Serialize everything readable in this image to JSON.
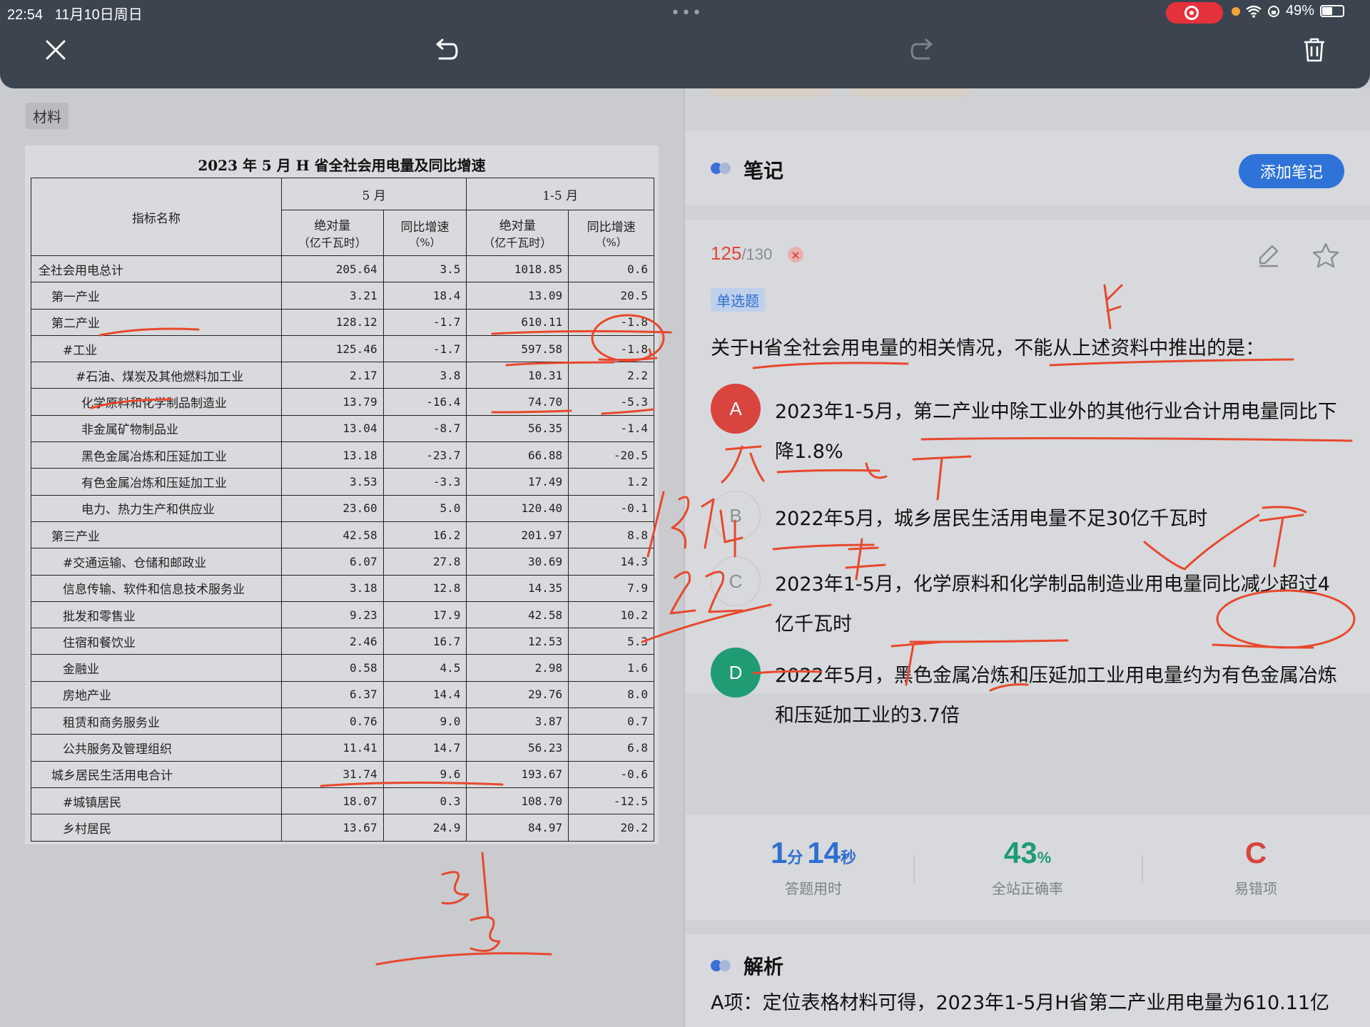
{
  "status_bar": {
    "time": "22:54",
    "date": "11月10日周日",
    "battery": "49%"
  },
  "toolbar": {
    "close_icon": "close-icon",
    "undo_icon": "undo-icon",
    "redo_icon": "redo-icon",
    "delete_icon": "trash-icon"
  },
  "material": {
    "tag": "材料",
    "table_title": "2023 年 5 月 H 省全社会用电量及同比增速",
    "headers": {
      "name": "指标名称",
      "group1": "5 月",
      "group2": "1-5 月",
      "abs_label": "绝对量",
      "abs_unit": "（亿千瓦时）",
      "growth_label": "同比增速",
      "growth_unit": "（%）"
    },
    "rows": [
      {
        "name": "全社会用电总计",
        "indent": 0,
        "may_abs": "205.64",
        "may_growth": "3.5",
        "ytd_abs": "1018.85",
        "ytd_growth": "0.6"
      },
      {
        "name": "第一产业",
        "indent": 1,
        "may_abs": "3.21",
        "may_growth": "18.4",
        "ytd_abs": "13.09",
        "ytd_growth": "20.5"
      },
      {
        "name": "第二产业",
        "indent": 1,
        "may_abs": "128.12",
        "may_growth": "-1.7",
        "ytd_abs": "610.11",
        "ytd_growth": "-1.8"
      },
      {
        "name": "#工业",
        "indent": 2,
        "may_abs": "125.46",
        "may_growth": "-1.7",
        "ytd_abs": "597.58",
        "ytd_growth": "-1.8"
      },
      {
        "name": "#石油、煤炭及其他燃料加工业",
        "indent": 3,
        "may_abs": "2.17",
        "may_growth": "3.8",
        "ytd_abs": "10.31",
        "ytd_growth": "2.2"
      },
      {
        "name": "化学原料和化学制品制造业",
        "indent": 4,
        "may_abs": "13.79",
        "may_growth": "-16.4",
        "ytd_abs": "74.70",
        "ytd_growth": "-5.3"
      },
      {
        "name": "非金属矿物制品业",
        "indent": 4,
        "may_abs": "13.04",
        "may_growth": "-8.7",
        "ytd_abs": "56.35",
        "ytd_growth": "-1.4"
      },
      {
        "name": "黑色金属冶炼和压延加工业",
        "indent": 4,
        "may_abs": "13.18",
        "may_growth": "-23.7",
        "ytd_abs": "66.88",
        "ytd_growth": "-20.5"
      },
      {
        "name": "有色金属冶炼和压延加工业",
        "indent": 4,
        "may_abs": "3.53",
        "may_growth": "-3.3",
        "ytd_abs": "17.49",
        "ytd_growth": "1.2"
      },
      {
        "name": "电力、热力生产和供应业",
        "indent": 4,
        "may_abs": "23.60",
        "may_growth": "5.0",
        "ytd_abs": "120.40",
        "ytd_growth": "-0.1"
      },
      {
        "name": "第三产业",
        "indent": 1,
        "may_abs": "42.58",
        "may_growth": "16.2",
        "ytd_abs": "201.97",
        "ytd_growth": "8.8"
      },
      {
        "name": "#交通运输、仓储和邮政业",
        "indent": 2,
        "may_abs": "6.07",
        "may_growth": "27.8",
        "ytd_abs": "30.69",
        "ytd_growth": "14.3"
      },
      {
        "name": "信息传输、软件和信息技术服务业",
        "indent": 2,
        "may_abs": "3.18",
        "may_growth": "12.8",
        "ytd_abs": "14.35",
        "ytd_growth": "7.9"
      },
      {
        "name": "批发和零售业",
        "indent": 2,
        "may_abs": "9.23",
        "may_growth": "17.9",
        "ytd_abs": "42.58",
        "ytd_growth": "10.2"
      },
      {
        "name": "住宿和餐饮业",
        "indent": 2,
        "may_abs": "2.46",
        "may_growth": "16.7",
        "ytd_abs": "12.53",
        "ytd_growth": "5.3"
      },
      {
        "name": "金融业",
        "indent": 2,
        "may_abs": "0.58",
        "may_growth": "4.5",
        "ytd_abs": "2.98",
        "ytd_growth": "1.6"
      },
      {
        "name": "房地产业",
        "indent": 2,
        "may_abs": "6.37",
        "may_growth": "14.4",
        "ytd_abs": "29.76",
        "ytd_growth": "8.0"
      },
      {
        "name": "租赁和商务服务业",
        "indent": 2,
        "may_abs": "0.76",
        "may_growth": "9.0",
        "ytd_abs": "3.87",
        "ytd_growth": "0.7"
      },
      {
        "name": "公共服务及管理组织",
        "indent": 2,
        "may_abs": "11.41",
        "may_growth": "14.7",
        "ytd_abs": "56.23",
        "ytd_growth": "6.8"
      },
      {
        "name": "城乡居民生活用电合计",
        "indent": 1,
        "may_abs": "31.74",
        "may_growth": "9.6",
        "ytd_abs": "193.67",
        "ytd_growth": "-0.6"
      },
      {
        "name": "#城镇居民",
        "indent": 2,
        "may_abs": "18.07",
        "may_growth": "0.3",
        "ytd_abs": "108.70",
        "ytd_growth": "-12.5"
      },
      {
        "name": "乡村居民",
        "indent": 2,
        "may_abs": "13.67",
        "may_growth": "24.9",
        "ytd_abs": "84.97",
        "ytd_growth": "20.2"
      }
    ]
  },
  "notes": {
    "title": "笔记",
    "add_button": "添加笔记"
  },
  "question": {
    "number": "125",
    "total": "/130",
    "wrong_mark": "×",
    "type": "单选题",
    "stem": "关于H省全社会用电量的相关情况，不能从上述资料中推出的是：",
    "options": [
      {
        "letter": "A",
        "text": "2023年1-5月，第二产业中除工业外的其他行业合计用电量同比下降1.8%",
        "style": "wrong",
        "color": "#d9443e"
      },
      {
        "letter": "B",
        "text": "2022年5月，城乡居民生活用电量不足30亿千瓦时",
        "style": "plain",
        "color": ""
      },
      {
        "letter": "C",
        "text": "2023年1-5月，化学原料和化学制品制造业用电量同比减少超过4亿千瓦时",
        "style": "plain",
        "color": ""
      },
      {
        "letter": "D",
        "text": "2022年5月，黑色金属冶炼和压延加工业用电量约为有色金属冶炼和压延加工业的3.7倍",
        "style": "correct",
        "color": "#1f9c74"
      }
    ]
  },
  "stats": {
    "time_min": "1",
    "time_min_unit": "分",
    "time_sec": "14",
    "time_sec_unit": "秒",
    "time_label": "答题用时",
    "accuracy": "43",
    "accuracy_unit": "%",
    "accuracy_label": "全站正确率",
    "error_option": "C",
    "error_label": "易错项"
  },
  "analysis": {
    "title": "解析",
    "text": "A项：定位表格材料可得，2023年1-5月H省第二产业用电量为610.11亿"
  },
  "colors": {
    "accent_blue": "#2f73d9",
    "wrong_red": "#d9443e",
    "correct_green": "#1f9c74",
    "ink": "#e8482d"
  }
}
